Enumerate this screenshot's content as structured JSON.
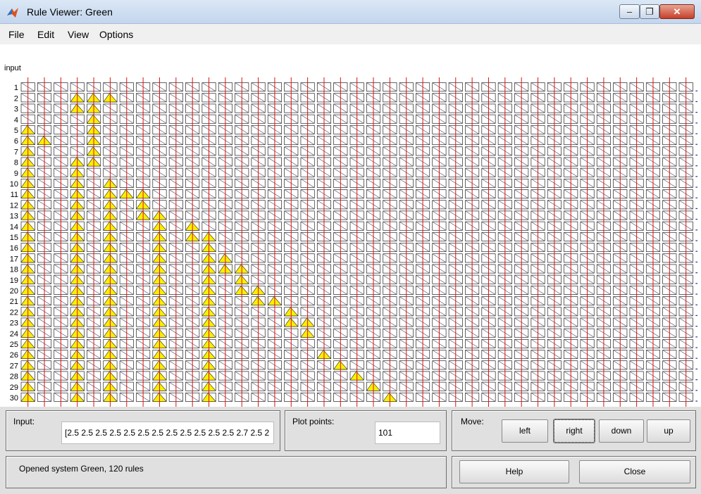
{
  "window": {
    "title": "Rule Viewer: Green"
  },
  "menu": {
    "items": [
      "File",
      "Edit",
      "View",
      "Options"
    ]
  },
  "plot": {
    "header_label": "input",
    "rows": [
      "1",
      "2",
      "3",
      "4",
      "5",
      "6",
      "7",
      "8",
      "9",
      "10",
      "11",
      "12",
      "13",
      "14",
      "15",
      "16",
      "17",
      "18",
      "19",
      "20",
      "21",
      "22",
      "23",
      "24",
      "25",
      "26",
      "27",
      "28",
      "29",
      "30"
    ],
    "line_color": "#dd1111",
    "fill_color": "#ffee00"
  },
  "controls": {
    "input_label": "Input:",
    "input_value": "[2.5 2.5 2.5 2.5 2.5 2.5 2.5 2.5 2.5 2.5 2.5 2.5 2.7 2.5 2",
    "plot_points_label": "Plot points:",
    "plot_points_value": "101",
    "move_label": "Move:",
    "left": "left",
    "right": "right",
    "down": "down",
    "up": "up",
    "status": "Opened system Green, 120 rules",
    "help": "Help",
    "close": "Close"
  }
}
